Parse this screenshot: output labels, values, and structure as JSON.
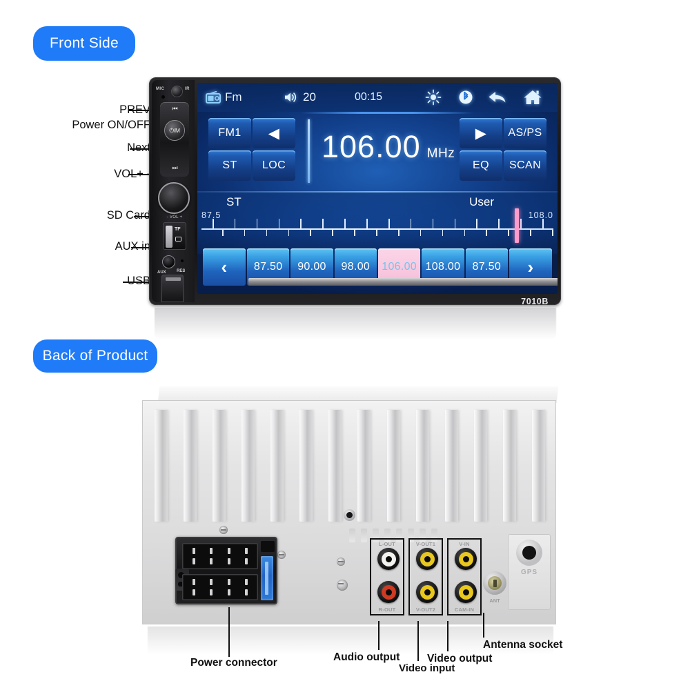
{
  "sections": {
    "front_badge": "Front Side",
    "back_badge": "Back of Product"
  },
  "front": {
    "model": "7010B",
    "callouts": [
      {
        "id": "prev",
        "label": "PREV"
      },
      {
        "id": "power",
        "label": "Power ON/OFF"
      },
      {
        "id": "next",
        "label": "Next"
      },
      {
        "id": "vol",
        "label": "VOL+ -"
      },
      {
        "id": "sd",
        "label": "SD Card"
      },
      {
        "id": "aux",
        "label": "AUX in"
      },
      {
        "id": "usb",
        "label": "USB"
      }
    ],
    "panel_marks": {
      "mic": "MIC",
      "ir": "IR",
      "power_btn": "⏻/M",
      "prev_glyph": "⏮",
      "next_glyph": "⏭",
      "vol_ring": "- VOL +",
      "tf": "TF",
      "aux": "AUX",
      "res": "RES"
    },
    "screen": {
      "status": {
        "source_icon": "radio-icon",
        "source_label": "Fm",
        "volume_icon": "speaker-icon",
        "volume_value": "20",
        "time": "00:15",
        "brightness_icon": "brightness-icon",
        "bluetooth_icon": "bluetooth-icon",
        "back_icon": "back-arrow-icon",
        "home_icon": "home-icon"
      },
      "controls": {
        "band": "FM1",
        "prev_arrow": "◀",
        "st": "ST",
        "loc": "LOC",
        "next_arrow": "▶",
        "asps": "AS/PS",
        "eq": "EQ",
        "scan": "SCAN"
      },
      "frequency": {
        "value": "106.00",
        "unit": "MHz"
      },
      "scale": {
        "stereo_label": "ST",
        "user_label": "User",
        "min": "87.5",
        "max": "108.0",
        "marker_percent": 89
      },
      "presets": {
        "prev_nav": "‹",
        "next_nav": "›",
        "items": [
          {
            "value": "87.50",
            "active": false
          },
          {
            "value": "90.00",
            "active": false
          },
          {
            "value": "98.00",
            "active": false
          },
          {
            "value": "106.00",
            "active": true
          },
          {
            "value": "108.00",
            "active": false
          },
          {
            "value": "87.50",
            "active": false
          }
        ]
      }
    }
  },
  "back": {
    "port_marks": {
      "l_out": "L-OUT",
      "r_out": "R-OUT",
      "v_out1": "V-OUT1",
      "v_out2": "V-OUT2",
      "v_in": "V-IN",
      "cam_in": "CAM-IN",
      "ant": "ANT",
      "gps": "GPS"
    },
    "callouts": [
      {
        "id": "power-connector",
        "label": "Power connector"
      },
      {
        "id": "audio-output",
        "label": "Audio output"
      },
      {
        "id": "video-input",
        "label": "Video input"
      },
      {
        "id": "video-output",
        "label": "Video output"
      },
      {
        "id": "antenna-socket",
        "label": "Antenna socket"
      }
    ]
  },
  "colors": {
    "badge_blue": "#1f7bf7",
    "screen_blue": "#12408c",
    "active_preset_pink": "#f8c9e0",
    "marker_pink": "#ff9ccb"
  }
}
